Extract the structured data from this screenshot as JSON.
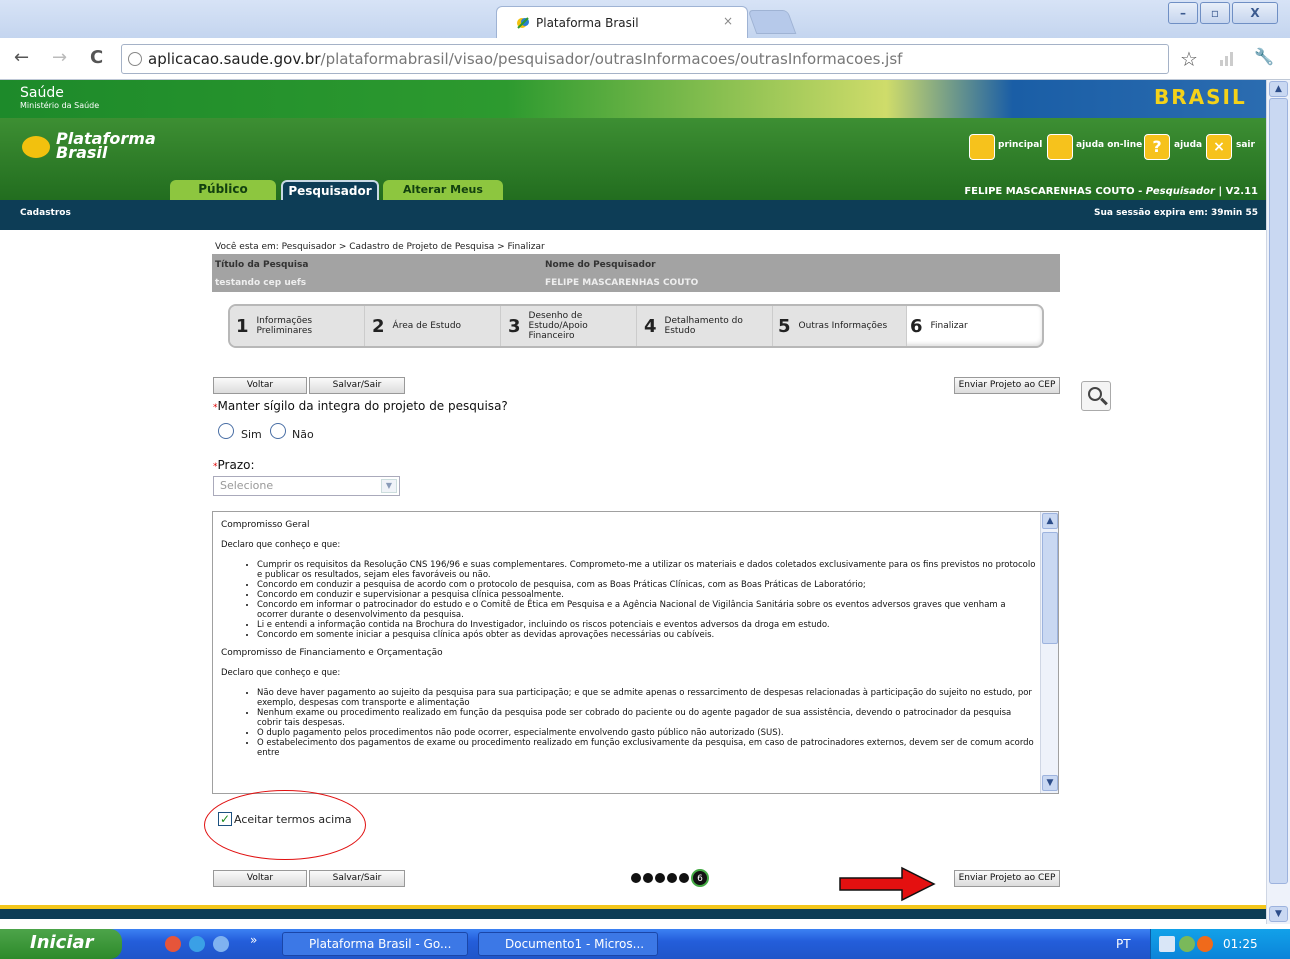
{
  "browser": {
    "tab_title": "Plataforma Brasil",
    "tab_close": "×",
    "url_host": "aplicacao.saude.gov.br",
    "url_path": "/plataformabrasil/visao/pesquisador/outrasInformacoes/outrasInformacoes.jsf",
    "nav_back": "←",
    "nav_forward": "→",
    "nav_reload": "C",
    "star": "☆",
    "wrench": "🔧"
  },
  "site": {
    "saude_title": "Saúde",
    "saude_sub": "Ministério da Saúde",
    "brasil_logo": "BRASIL",
    "logo_line1": "Plataforma",
    "logo_line2": "Brasil",
    "top_links": [
      "principal",
      "ajuda on-line",
      "ajuda",
      "sair"
    ],
    "tabs": [
      "Público",
      "Pesquisador",
      "Alterar Meus Dados"
    ],
    "user_name": "FELIPE MASCARENHAS COUTO",
    "user_sep": " - ",
    "user_role": "Pesquisador",
    "version": "| V2.11",
    "section": "Cadastros",
    "session": "Sua sessão expira em: 39min 55"
  },
  "content": {
    "breadcrumb": "Você esta em: Pesquisador > Cadastro de Projeto de Pesquisa > Finalizar",
    "titulo_label": "Título da Pesquisa",
    "titulo_value": "testando cep uefs",
    "nome_label": "Nome do Pesquisador",
    "nome_value": "FELIPE MASCARENHAS COUTO",
    "steps": [
      {
        "n": "1",
        "l": "Informações Preliminares"
      },
      {
        "n": "2",
        "l": "Área de Estudo"
      },
      {
        "n": "3",
        "l": "Desenho de Estudo/Apoio Financeiro"
      },
      {
        "n": "4",
        "l": "Detalhamento do Estudo"
      },
      {
        "n": "5",
        "l": "Outras Informações"
      },
      {
        "n": "6",
        "l": "Finalizar"
      }
    ],
    "btn_voltar": "Voltar",
    "btn_salvar": "Salvar/Sair",
    "btn_enviar": "Enviar Projeto ao CEP",
    "req_mark": "*",
    "q_sigilo": "Manter sígilo da integra do projeto de pesquisa?",
    "opt_sim": "Sim",
    "opt_nao": "Não",
    "q_prazo": "Prazo:",
    "select_placeholder": "Selecione",
    "terms_h1": "Compromisso Geral",
    "terms_intro1": "Declaro que conheço e que:",
    "terms_list1": [
      "Cumprir os requisitos da Resolução CNS 196/96 e suas complementares. Comprometo-me a utilizar os materiais e dados coletados exclusivamente para os fins previstos no protocolo e publicar os resultados, sejam eles favoráveis ou não.",
      "Concordo em conduzir a pesquisa de acordo com o protocolo de pesquisa, com as Boas Práticas Clínicas, com as Boas Práticas de Laboratório;",
      "Concordo em conduzir e supervisionar a pesquisa clínica pessoalmente.",
      "Concordo em informar o patrocinador do estudo e o Comitê de Ética em Pesquisa e a Agência Nacional de Vigilância Sanitária sobre os eventos adversos graves que venham a ocorrer durante o desenvolvimento da pesquisa.",
      "Li e entendi a informação contida na Brochura do Investigador, incluindo os riscos potenciais e eventos adversos da droga em estudo.",
      "Concordo em somente iniciar a pesquisa clínica após obter as devidas aprovações necessárias ou cabíveis."
    ],
    "terms_h2": "Compromisso de Financiamento e Orçamentação",
    "terms_intro2": "Declaro que conheço e que:",
    "terms_list2": [
      "Não deve haver pagamento ao sujeito da pesquisa para sua participação; e que se admite apenas o ressarcimento de despesas relacionadas à participação do sujeito no estudo, por exemplo, despesas com transporte e alimentação",
      "Nenhum exame ou procedimento realizado em função da pesquisa pode ser cobrado do paciente ou do agente pagador de sua assistência, devendo o patrocinador da pesquisa cobrir tais despesas.",
      "O duplo pagamento pelos procedimentos não pode ocorrer, especialmente envolvendo gasto público não autorizado (SUS).",
      "O estabelecimento dos pagamentos de exame ou procedimento realizado em função exclusivamente da pesquisa, em caso de patrocinadores externos, devem ser de comum acordo entre"
    ],
    "accept_label": "Aceitar termos acima",
    "accept_check": "✓",
    "pager_current": "6"
  },
  "taskbar": {
    "start": "Iniciar",
    "chevron": "»",
    "items": [
      "Plataforma Brasil - Go...",
      "Documento1 - Micros..."
    ],
    "lang": "PT",
    "time": "01:25"
  }
}
